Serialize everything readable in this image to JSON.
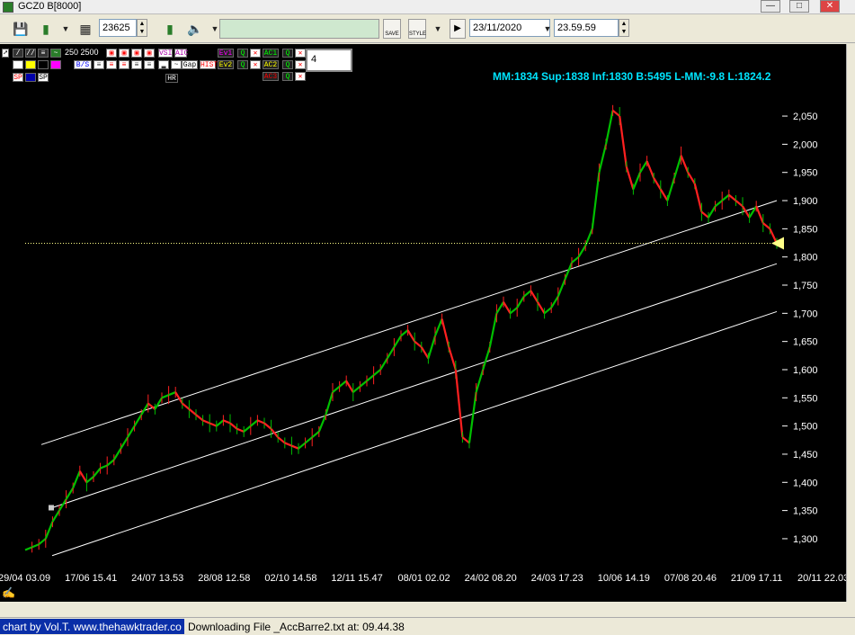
{
  "window": {
    "title": "GCZ0 B[8000]"
  },
  "toolbar": {
    "bars_value": "23625",
    "date_value": "23/11/2020",
    "time_value": "23.59.59",
    "save_label": "SAVE",
    "style_label": "STYLE"
  },
  "panel": {
    "periods_label": "250  2500",
    "input_value": "4",
    "btn_ev1": "Ev1",
    "btn_ev2": "Ev2",
    "btn_ac1": "AC1",
    "btn_ac2": "AC2",
    "btn_ac3": "AC3",
    "btn_vsi": "VSI",
    "btn_aic": "AIC",
    "btn_gap": "Gap",
    "btn_hist": "HIST",
    "btn_hr": "HR",
    "btn_sp1": "SP",
    "btn_sp2": "SP",
    "btn_bs": "B/S"
  },
  "info": {
    "text": "MM:1834 Sup:1838 Inf:1830 B:5495 L-MM:-9.8 L:1824.2"
  },
  "chart_data": {
    "type": "line",
    "title": "",
    "y_ticks": [
      "2,050",
      "2,000",
      "1,950",
      "1,900",
      "1,850",
      "1,800",
      "1,750",
      "1,700",
      "1,650",
      "1,600",
      "1,550",
      "1,500",
      "1,450",
      "1,400",
      "1,350",
      "1,300"
    ],
    "x_ticks": [
      "29/04 03.09",
      "17/06 15.41",
      "24/07 13.53",
      "28/08 12.58",
      "02/10 14.58",
      "12/11 15.47",
      "08/01 02.02",
      "24/02 08.20",
      "24/03 17.23",
      "10/06 14.19",
      "07/08 20.46",
      "21/09 17.11",
      "20/11 22.03"
    ],
    "ylim": [
      1260,
      2090
    ],
    "last_price": 1824.2,
    "series": [
      {
        "values": [
          1280,
          1285,
          1290,
          1300,
          1330,
          1350,
          1370,
          1390,
          1420,
          1400,
          1410,
          1425,
          1430,
          1440,
          1460,
          1480,
          1500,
          1520,
          1540,
          1530,
          1550,
          1555,
          1560,
          1540,
          1530,
          1520,
          1510,
          1505,
          1500,
          1510,
          1505,
          1495,
          1490,
          1500,
          1510,
          1505,
          1495,
          1480,
          1470,
          1465,
          1460,
          1470,
          1480,
          1490,
          1520,
          1560,
          1570,
          1580,
          1560,
          1570,
          1580,
          1590,
          1600,
          1620,
          1640,
          1660,
          1670,
          1650,
          1640,
          1620,
          1660,
          1690,
          1640,
          1600,
          1480,
          1470,
          1560,
          1600,
          1640,
          1700,
          1720,
          1700,
          1710,
          1730,
          1740,
          1720,
          1700,
          1710,
          1730,
          1760,
          1790,
          1800,
          1820,
          1850,
          1950,
          2000,
          2060,
          2050,
          1960,
          1920,
          1950,
          1970,
          1940,
          1920,
          1900,
          1940,
          1980,
          1950,
          1930,
          1880,
          1870,
          1890,
          1900,
          1910,
          1900,
          1890,
          1870,
          1890,
          1860,
          1850,
          1824
        ]
      }
    ],
    "channel_lines": [
      {
        "name": "",
        "start": 1467,
        "end": 1900
      },
      {
        "name": "",
        "start": 1355,
        "end": 1788
      },
      {
        "name": "",
        "start": 1270,
        "end": 1703
      }
    ],
    "grid": false,
    "colors": {
      "up": "#00c000",
      "down": "#ff2020",
      "channel": "#ffffff",
      "marker": "#ffff88",
      "axis_text": "#ffffff"
    }
  },
  "status": {
    "left": "chart by Vol.T. www.thehawktrader.co",
    "right": "Downloading File _AccBarre2.txt at: 09.44.38"
  }
}
